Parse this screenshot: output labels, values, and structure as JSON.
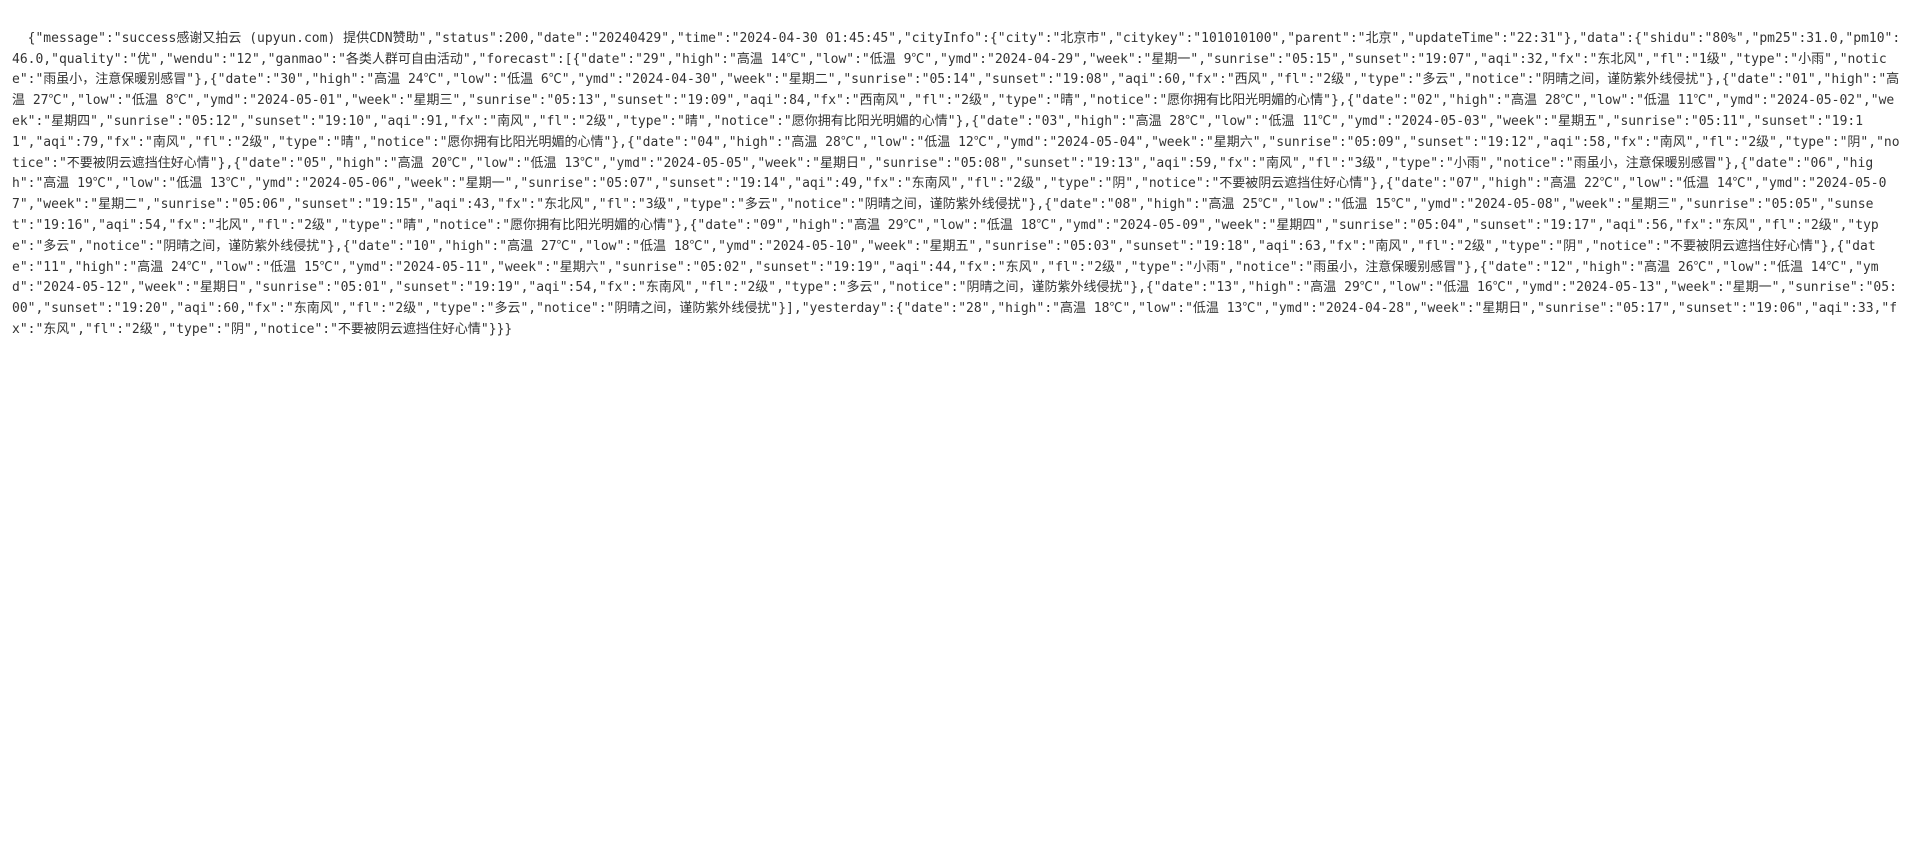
{
  "content": {
    "raw_text": "{\"message\":\"success感谢又拍云 (upyun.com) 提供CDN赞助\",\"status\":200,\"date\":\"20240429\",\"time\":\"2024-04-30 01:45:45\",\"cityInfo\":{\"city\":\"北京市\",\"citykey\":\"101010100\",\"parent\":\"北京\",\"updateTime\":\"22:31\"},\"data\":{\"shidu\":\"80%\",\"pm25\":31.0,\"pm10\":46.0,\"quality\":\"优\",\"wendu\":\"12\",\"ganmao\":\"各类人群可自由活动\",\"forecast\":[{\"date\":\"29\",\"high\":\"高温 14℃\",\"low\":\"低温 9℃\",\"ymd\":\"2024-04-29\",\"week\":\"星期一\",\"sunrise\":\"05:15\",\"sunset\":\"19:07\",\"aqi\":32,\"fx\":\"东北风\",\"fl\":\"1级\",\"type\":\"小雨\",\"notice\":\"雨虽小，注意保暖别感冒\"},{\"date\":\"30\",\"high\":\"高温 24℃\",\"low\":\"低温 6℃\",\"ymd\":\"2024-04-30\",\"week\":\"星期二\",\"sunrise\":\"05:14\",\"sunset\":\"19:08\",\"aqi\":60,\"fx\":\"西风\",\"fl\":\"2级\",\"type\":\"多云\",\"notice\":\"阴晴之间，谨防紫外线侵扰\"},{\"date\":\"01\",\"high\":\"高温 27℃\",\"low\":\"低温 8℃\",\"ymd\":\"2024-05-01\",\"week\":\"星期三\",\"sunrise\":\"05:13\",\"sunset\":\"19:09\",\"aqi\":84,\"fx\":\"西南风\",\"fl\":\"2级\",\"type\":\"晴\",\"notice\":\"愿你拥有比阳光明媚的心情\"},{\"date\":\"02\",\"high\":\"高温 28℃\",\"low\":\"低温 11℃\",\"ymd\":\"2024-05-02\",\"week\":\"星期四\",\"sunrise\":\"05:12\",\"sunset\":\"19:10\",\"aqi\":91,\"fx\":\"南风\",\"fl\":\"2级\",\"type\":\"晴\",\"notice\":\"愿你拥有比阳光明媚的心情\"},{\"date\":\"03\",\"high\":\"高温 28℃\",\"low\":\"低温 11℃\",\"ymd\":\"2024-05-03\",\"week\":\"星期五\",\"sunrise\":\"05:11\",\"sunset\":\"19:11\",\"aqi\":79,\"fx\":\"南风\",\"fl\":\"2级\",\"type\":\"晴\",\"notice\":\"愿你拥有比阳光明媚的心情\"},{\"date\":\"04\",\"high\":\"高温 28℃\",\"low\":\"低温 12℃\",\"ymd\":\"2024-05-04\",\"week\":\"星期六\",\"sunrise\":\"05:09\",\"sunset\":\"19:12\",\"aqi\":58,\"fx\":\"南风\",\"fl\":\"2级\",\"type\":\"阴\",\"notice\":\"不要被阴云遮挡住好心情\"},{\"date\":\"05\",\"high\":\"高温 20℃\",\"low\":\"低温 13℃\",\"ymd\":\"2024-05-05\",\"week\":\"星期日\",\"sunrise\":\"05:08\",\"sunset\":\"19:13\",\"aqi\":59,\"fx\":\"南风\",\"fl\":\"3级\",\"type\":\"小雨\",\"notice\":\"雨虽小，注意保暖别感冒\"},{\"date\":\"06\",\"high\":\"高温 19℃\",\"low\":\"低温 13℃\",\"ymd\":\"2024-05-06\",\"week\":\"星期一\",\"sunrise\":\"05:07\",\"sunset\":\"19:14\",\"aqi\":49,\"fx\":\"东南风\",\"fl\":\"2级\",\"type\":\"阴\",\"notice\":\"不要被阴云遮挡住好心情\"},{\"date\":\"07\",\"high\":\"高温 22℃\",\"low\":\"低温 14℃\",\"ymd\":\"2024-05-07\",\"week\":\"星期二\",\"sunrise\":\"05:06\",\"sunset\":\"19:15\",\"aqi\":43,\"fx\":\"东北风\",\"fl\":\"3级\",\"type\":\"多云\",\"notice\":\"阴晴之间，谨防紫外线侵扰\"},{\"date\":\"08\",\"high\":\"高温 25℃\",\"low\":\"低温 15℃\",\"ymd\":\"2024-05-08\",\"week\":\"星期三\",\"sunrise\":\"05:05\",\"sunset\":\"19:16\",\"aqi\":54,\"fx\":\"北风\",\"fl\":\"2级\",\"type\":\"晴\",\"notice\":\"愿你拥有比阳光明媚的心情\"},{\"date\":\"09\",\"high\":\"高温 29℃\",\"low\":\"低温 18℃\",\"ymd\":\"2024-05-09\",\"week\":\"星期四\",\"sunrise\":\"05:04\",\"sunset\":\"19:17\",\"aqi\":56,\"fx\":\"东风\",\"fl\":\"2级\",\"type\":\"多云\",\"notice\":\"阴晴之间，谨防紫外线侵扰\"},{\"date\":\"10\",\"high\":\"高温 27℃\",\"low\":\"低温 18℃\",\"ymd\":\"2024-05-10\",\"week\":\"星期五\",\"sunrise\":\"05:03\",\"sunset\":\"19:18\",\"aqi\":63,\"fx\":\"南风\",\"fl\":\"2级\",\"type\":\"阴\",\"notice\":\"不要被阴云遮挡住好心情\"},{\"date\":\"11\",\"high\":\"高温 24℃\",\"low\":\"低温 15℃\",\"ymd\":\"2024-05-11\",\"week\":\"星期六\",\"sunrise\":\"05:02\",\"sunset\":\"19:19\",\"aqi\":44,\"fx\":\"东风\",\"fl\":\"2级\",\"type\":\"小雨\",\"notice\":\"雨虽小，注意保暖别感冒\"},{\"date\":\"12\",\"high\":\"高温 26℃\",\"low\":\"低温 14℃\",\"ymd\":\"2024-05-12\",\"week\":\"星期日\",\"sunrise\":\"05:01\",\"sunset\":\"19:19\",\"aqi\":54,\"fx\":\"东南风\",\"fl\":\"2级\",\"type\":\"多云\",\"notice\":\"阴晴之间，谨防紫外线侵扰\"},{\"date\":\"13\",\"high\":\"高温 29℃\",\"low\":\"低温 16℃\",\"ymd\":\"2024-05-13\",\"week\":\"星期一\",\"sunrise\":\"05:00\",\"sunset\":\"19:20\",\"aqi\":60,\"fx\":\"东南风\",\"fl\":\"2级\",\"type\":\"多云\",\"notice\":\"阴晴之间，谨防紫外线侵扰\"}],\"yesterday\":{\"date\":\"28\",\"high\":\"高温 18℃\",\"low\":\"低温 13℃\",\"ymd\":\"2024-04-28\",\"week\":\"星期日\",\"sunrise\":\"05:17\",\"sunset\":\"19:06\",\"aqi\":33,\"fx\":\"东风\",\"fl\":\"2级\",\"type\":\"阴\",\"notice\":\"不要被阴云遮挡住好心情\"}}}"
  }
}
